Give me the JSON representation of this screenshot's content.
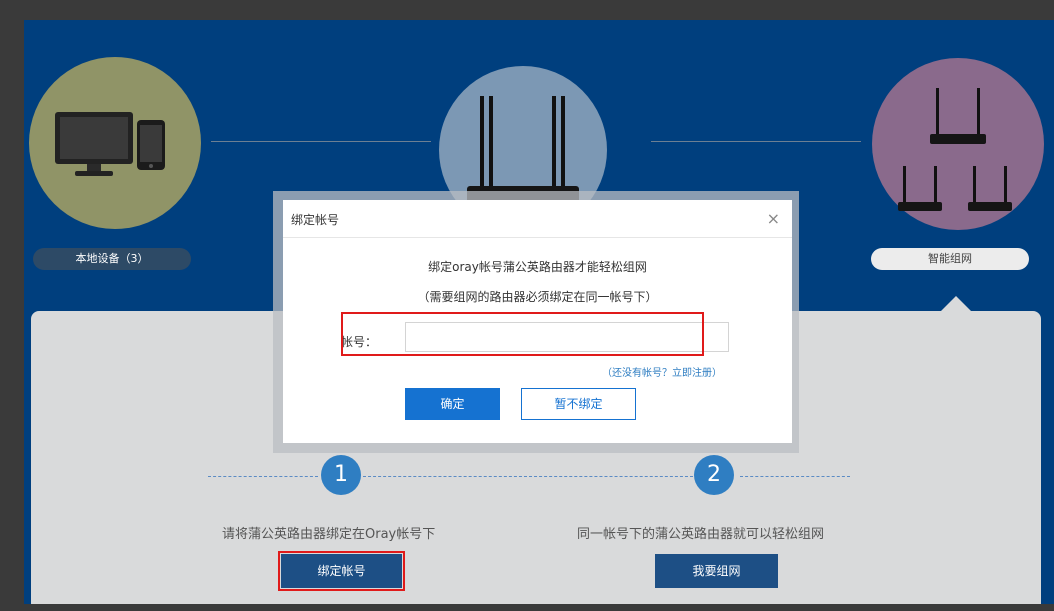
{
  "header": {
    "local_devices_label": "本地设备（3）",
    "mesh_label": "智能组网"
  },
  "steps": [
    {
      "number": "1",
      "caption": "请将蒲公英路由器绑定在Oray帐号下",
      "button": "绑定帐号"
    },
    {
      "number": "2",
      "caption": "同一帐号下的蒲公英路由器就可以轻松组网",
      "button": "我要组网"
    }
  ],
  "dialog": {
    "title": "绑定帐号",
    "close": "×",
    "line1": "绑定oray帐号蒲公英路由器才能轻松组网",
    "line2": "（需要组网的路由器必须绑定在同一帐号下）",
    "account_label": "帐号：",
    "account_value": "",
    "account_placeholder": "",
    "register_link": "（还没有帐号？立即注册）",
    "confirm_label": "确定",
    "skip_label": "暂不绑定"
  },
  "colors": {
    "background": "#003f7e",
    "accent": "#1572d1",
    "highlight": "#e01a1a"
  },
  "icons": {
    "local": "computer-and-tablet-icon",
    "router": "router-icon",
    "mesh": "three-routers-icon"
  }
}
